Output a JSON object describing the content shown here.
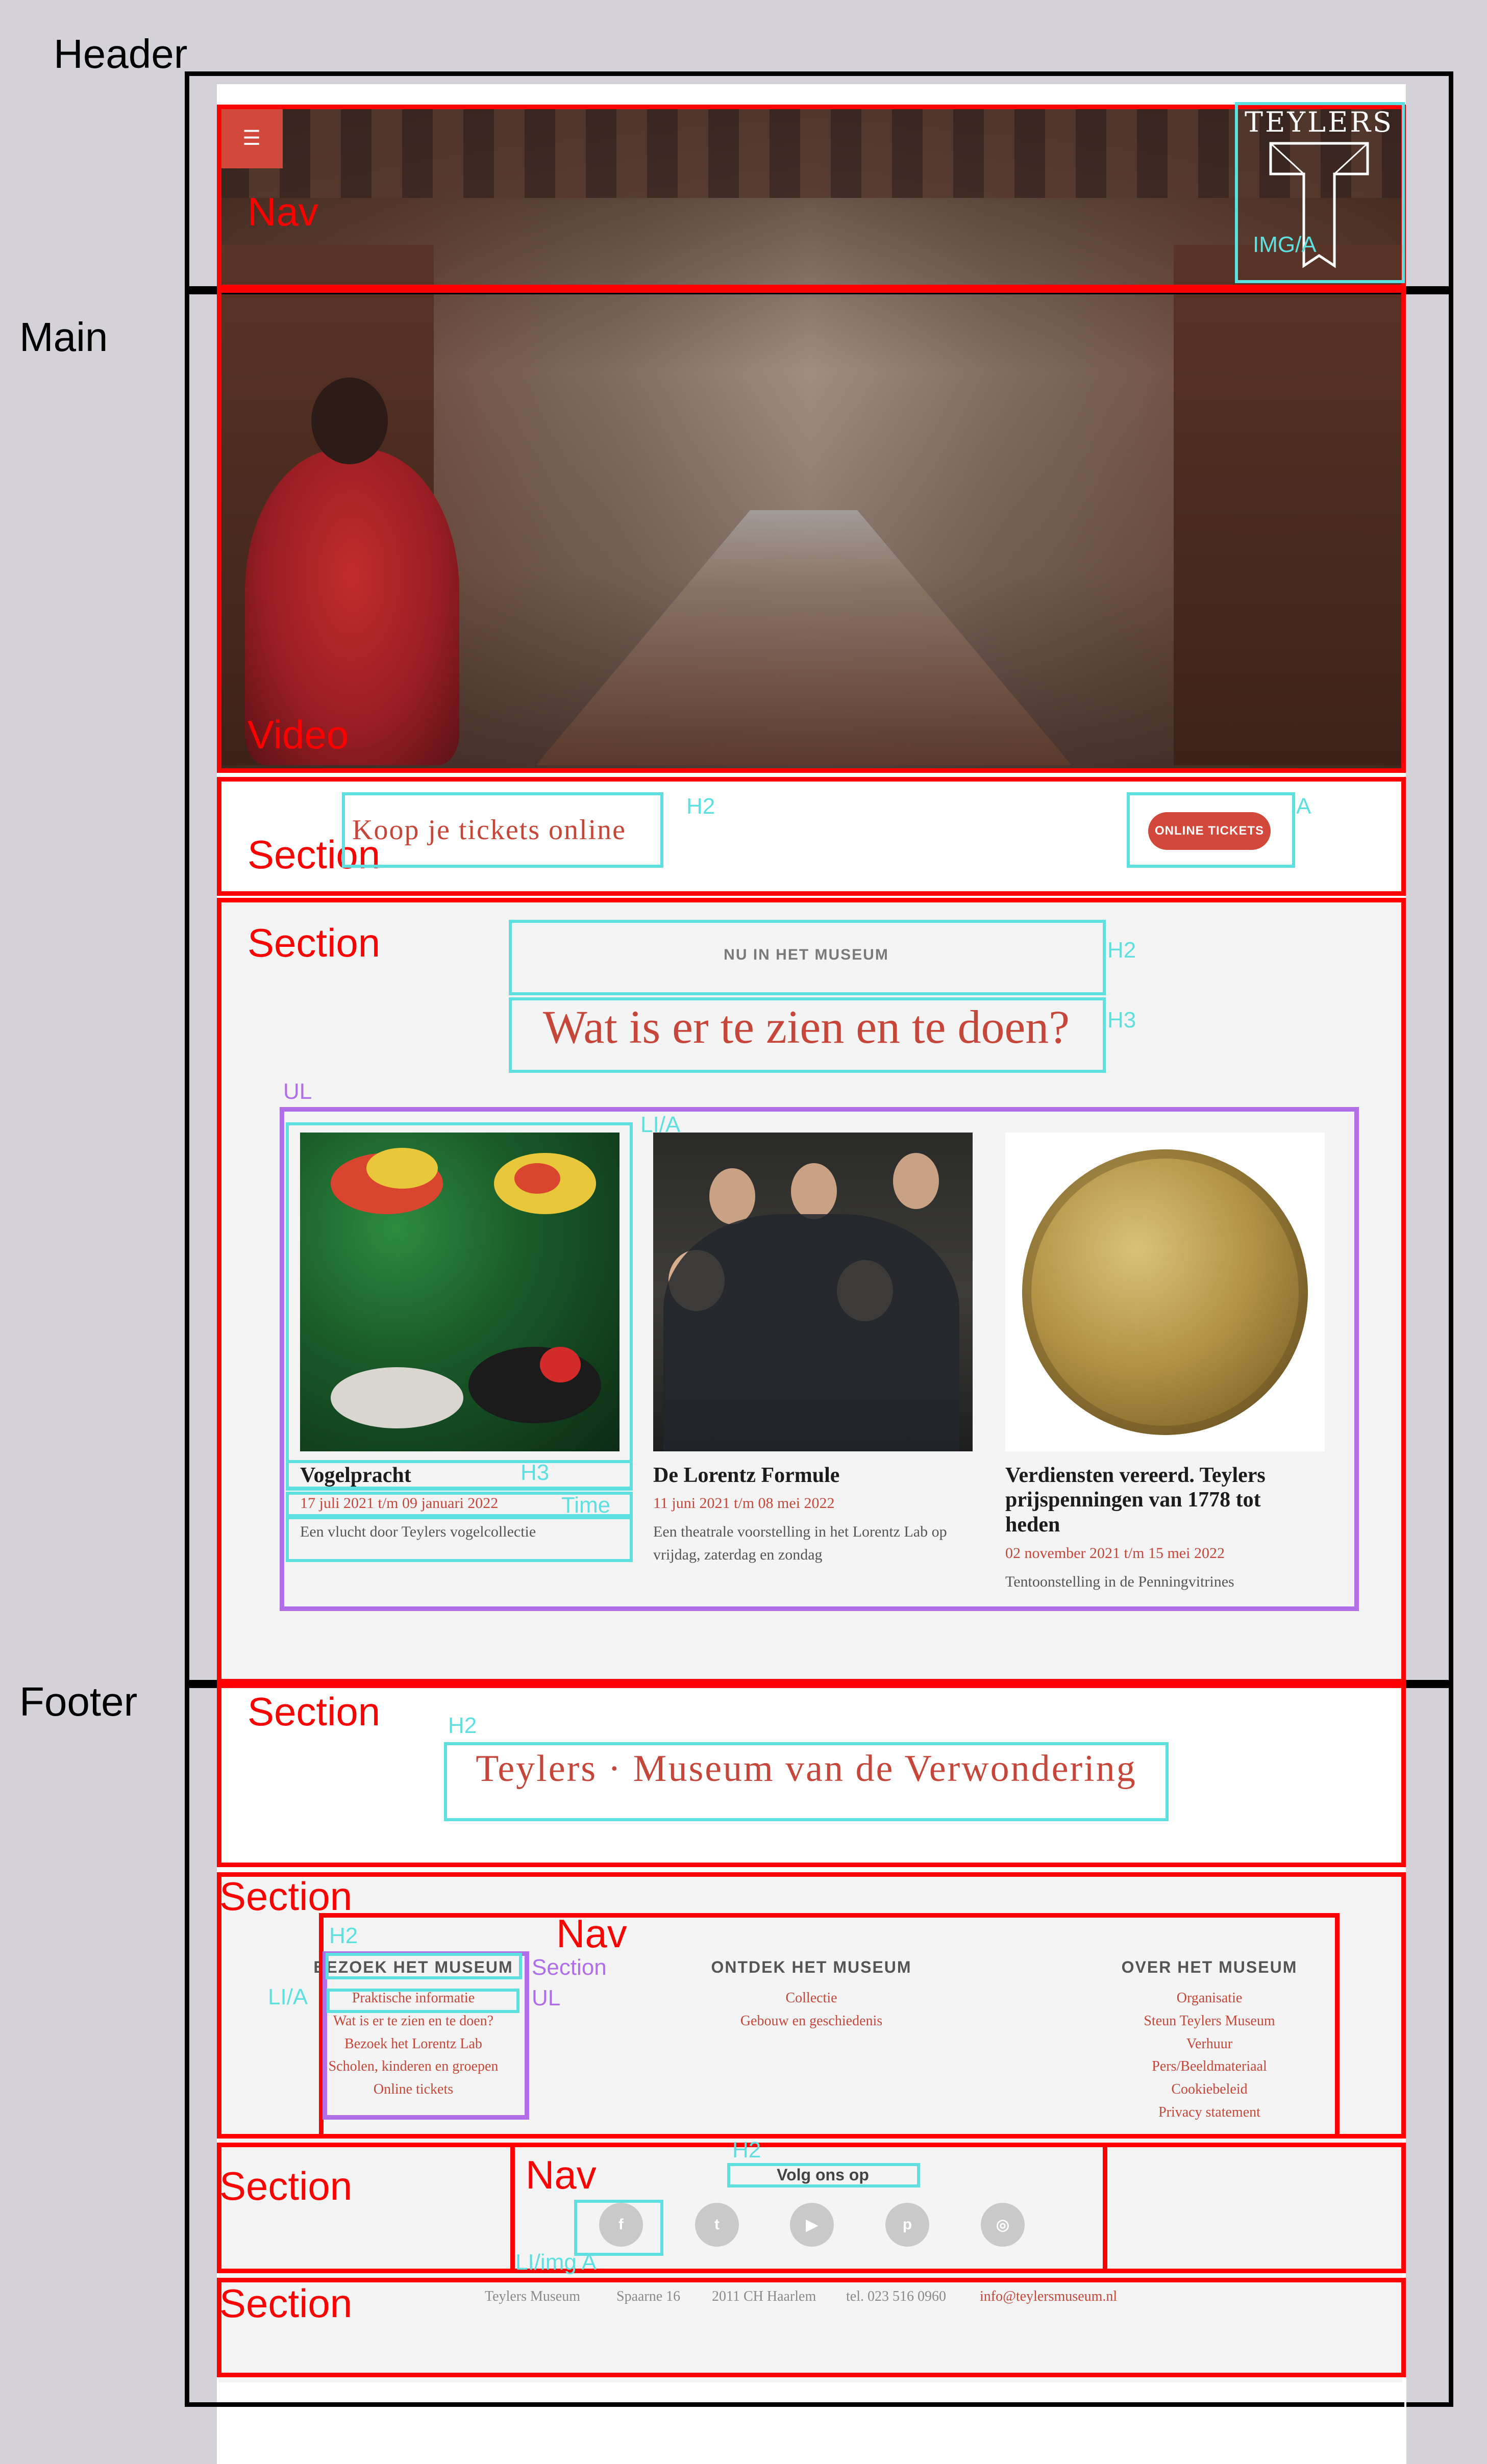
{
  "annotations": {
    "header": "Header",
    "main": "Main",
    "footer": "Footer",
    "nav": "Nav",
    "video": "Video",
    "section": "Section",
    "img_a": "IMG/A",
    "h2": "H2",
    "h3": "H3",
    "a": "A",
    "ul": "UL",
    "li_a": "LI/A",
    "time": "Time",
    "li_img_a": "LI/img A"
  },
  "header": {
    "menu_icon": "hamburger-icon",
    "logo_text": "TEYLERS"
  },
  "tickets": {
    "heading": "Koop je tickets online",
    "button": "ONLINE TICKETS"
  },
  "whatson": {
    "kicker": "NU IN HET MUSEUM",
    "heading": "Wat is er te zien en te doen?",
    "cards": [
      {
        "title": "Vogelpracht",
        "date": "17 juli 2021 t/m 09 januari 2022",
        "desc": "Een vlucht door Teylers vogelcollectie"
      },
      {
        "title": "De Lorentz Formule",
        "date": "11 juni 2021 t/m 08 mei 2022",
        "desc": "Een theatrale voorstelling in het Lorentz Lab op vrijdag, zaterdag en zondag"
      },
      {
        "title": "Verdiensten vereerd. Teylers prijspenningen van 1778 tot heden",
        "date": "02 november 2021 t/m 15 mei 2022",
        "desc": "Tentoonstelling in de Penningvitrines"
      }
    ]
  },
  "footer": {
    "title": "Teylers · Museum van de Verwondering",
    "columns": [
      {
        "title": "BEZOEK HET MUSEUM",
        "links": [
          "Praktische informatie",
          "Wat is er te zien en te doen?",
          "Bezoek het Lorentz Lab",
          "Scholen, kinderen en groepen",
          "Online tickets"
        ]
      },
      {
        "title": "ONTDEK HET MUSEUM",
        "links": [
          "Collectie",
          "Gebouw en geschiedenis"
        ]
      },
      {
        "title": "OVER HET MUSEUM",
        "links": [
          "Organisatie",
          "Steun Teylers Museum",
          "Verhuur",
          "Pers/Beeldmateriaal",
          "Cookiebeleid",
          "Privacy statement"
        ]
      }
    ],
    "follow": "Volg ons op",
    "social": [
      {
        "icon": "facebook-icon",
        "glyph": "f"
      },
      {
        "icon": "twitter-icon",
        "glyph": "t"
      },
      {
        "icon": "youtube-icon",
        "glyph": "▶"
      },
      {
        "icon": "pinterest-icon",
        "glyph": "p"
      },
      {
        "icon": "instagram-icon",
        "glyph": "◎"
      }
    ],
    "contact": {
      "name": "Teylers Museum",
      "street": "Spaarne 16",
      "city": "2011 CH Haarlem",
      "phone": "tel. 023 516 0960",
      "email": "info@teylersmuseum.nl"
    }
  }
}
